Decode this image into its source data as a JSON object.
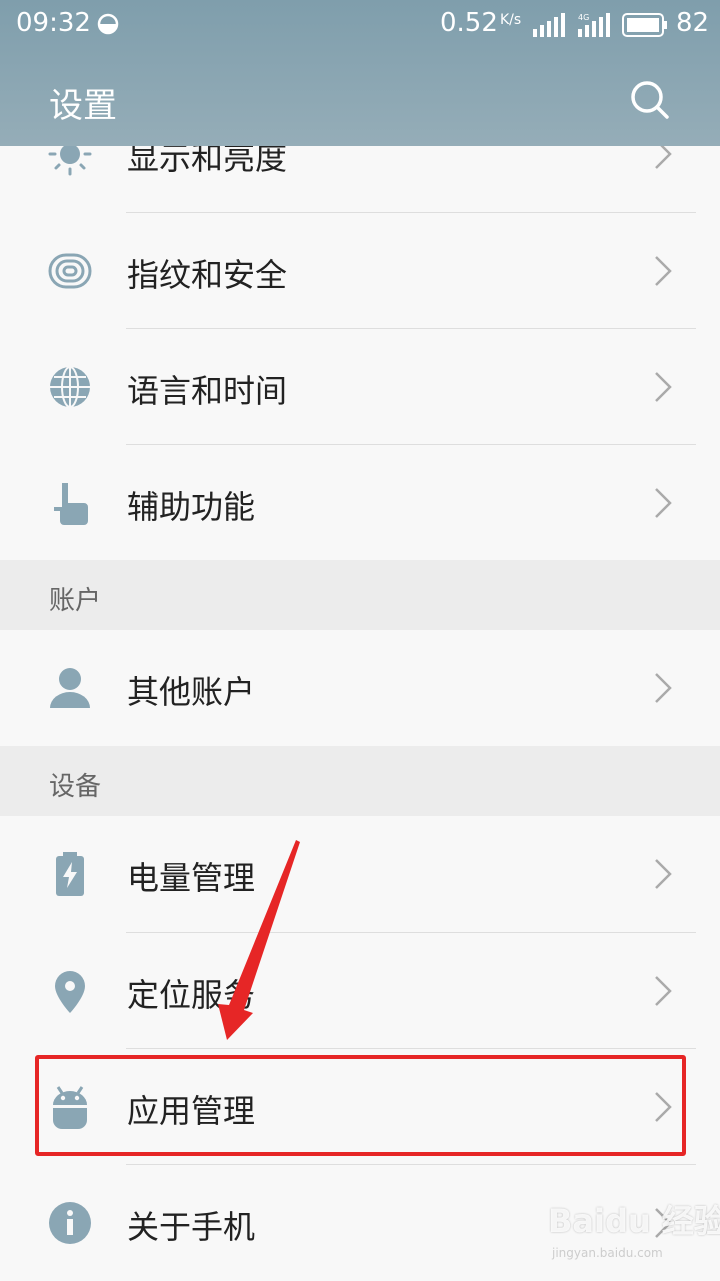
{
  "status_bar": {
    "time": "09:32",
    "network_speed": "0.52",
    "speed_unit": "K/s",
    "signal_label": "4G",
    "battery": "82"
  },
  "header": {
    "title": "设置",
    "search_icon": "search-icon"
  },
  "items": [
    {
      "label": "显示和亮度",
      "icon": "brightness-icon"
    },
    {
      "label": "指纹和安全",
      "icon": "fingerprint-icon"
    },
    {
      "label": "语言和时间",
      "icon": "globe-icon"
    },
    {
      "label": "辅助功能",
      "icon": "hand-pointer-icon"
    }
  ],
  "sections": [
    {
      "title": "账户",
      "items": [
        {
          "label": "其他账户",
          "icon": "user-icon"
        }
      ]
    },
    {
      "title": "设备",
      "items": [
        {
          "label": "电量管理",
          "icon": "battery-icon"
        },
        {
          "label": "定位服务",
          "icon": "location-pin-icon"
        },
        {
          "label": "应用管理",
          "icon": "android-icon"
        },
        {
          "label": "关于手机",
          "icon": "info-icon"
        }
      ]
    }
  ],
  "annotation": {
    "highlight_color": "#e62626",
    "highlighted_item": "应用管理"
  },
  "watermark": {
    "text": "Baidu 经验",
    "url": "jingyan.baidu.com"
  },
  "colors": {
    "icon": "#8aa6b4",
    "header": "#89a6b3",
    "section_bg": "#ececec"
  }
}
